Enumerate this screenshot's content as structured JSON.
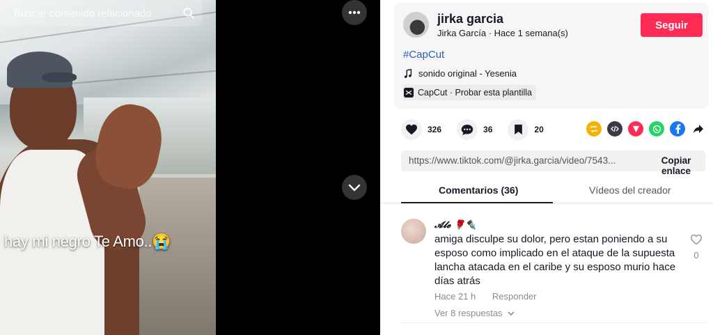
{
  "search": {
    "placeholder": "Buscar contenido relacionado"
  },
  "video": {
    "caption": "hay mi negro Te Amo..😭"
  },
  "author": {
    "username": "jirka garcia",
    "display_name": "Jirka García",
    "separator": "·",
    "posted": "Hace 1 semana(s)",
    "follow_label": "Seguir"
  },
  "post": {
    "hashtag": "#CapCut",
    "sound": "sonido original - Yesenia",
    "template": "CapCut · Probar esta plantilla"
  },
  "stats": {
    "likes": "326",
    "comments": "36",
    "saves": "20"
  },
  "share_icons": [
    "repost-icon",
    "embed-icon",
    "send-icon",
    "whatsapp-icon",
    "facebook-icon",
    "share-arrow-icon"
  ],
  "link": {
    "url": "https://www.tiktok.com/@jirka.garcia/video/7543...",
    "copy_label": "Copiar enlace"
  },
  "tabs": [
    {
      "label": "Comentarios (36)"
    },
    {
      "label": "Vídeos del creador"
    }
  ],
  "comment": {
    "author": "𝓐𝓵𝓮 🌹✒️",
    "text": "amiga disculpe su dolor, pero estan poniendo a su esposo como implicado en el ataque de la supuesta lancha atacada en el caribe y su esposo murio hace días atrás",
    "time": "Hace 21 h",
    "reply_label": "Responder",
    "likes": "0",
    "view_replies": "Ver 8 respuestas"
  },
  "colors": {
    "accent": "#fe2c55",
    "hashtag": "#2b5db9",
    "text": "#161823",
    "muted": "#8a8b91"
  }
}
